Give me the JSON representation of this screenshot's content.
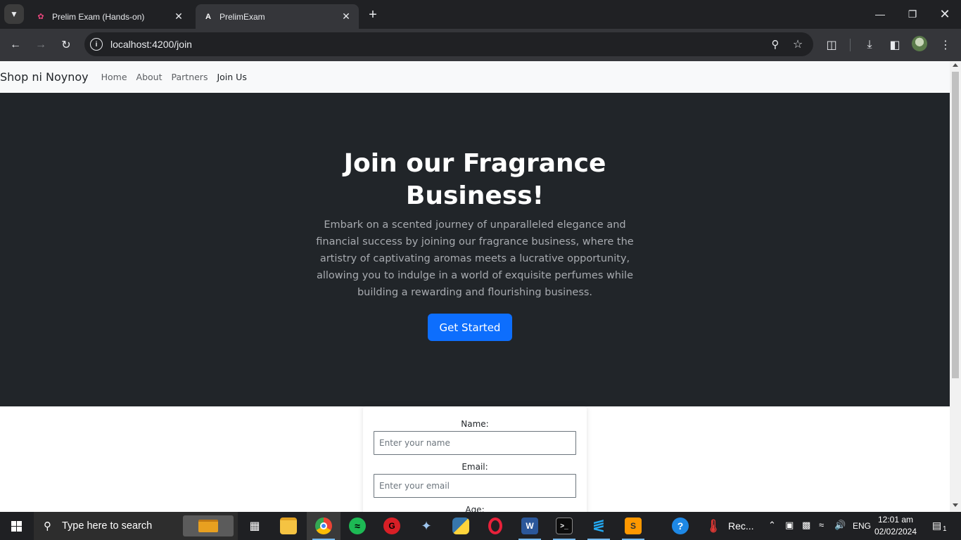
{
  "browser": {
    "tabs": [
      {
        "title": "Prelim Exam (Hands-on)",
        "favicon": "pinwheel-icon",
        "active": false
      },
      {
        "title": "PrelimExam",
        "favicon": "angular-icon",
        "active": true
      }
    ],
    "url": "localhost:4200/join"
  },
  "site": {
    "brand": "Shop ni Noynoy",
    "nav": [
      "Home",
      "About",
      "Partners",
      "Join Us"
    ],
    "hero": {
      "title": "Join our Fragrance Business!",
      "description": "Embark on a scented journey of unparalleled elegance and financial success by joining our fragrance business, where the artistry of captivating aromas meets a lucrative opportunity, allowing you to indulge in a world of exquisite perfumes while building a rewarding and flourishing business.",
      "cta": "Get Started"
    },
    "form": {
      "name_label": "Name:",
      "name_placeholder": "Enter your name",
      "email_label": "Email:",
      "email_placeholder": "Enter your email",
      "age_label": "Age:"
    }
  },
  "taskbar": {
    "search_placeholder": "Type here to search",
    "weather_text": "Rec...",
    "language": "ENG",
    "time": "12:01 am",
    "date": "02/02/2024",
    "notification_count": "1"
  },
  "colors": {
    "hero_bg": "#212529",
    "cta_bg": "#0d6efd",
    "navbar_bg": "#f8f9fa"
  }
}
